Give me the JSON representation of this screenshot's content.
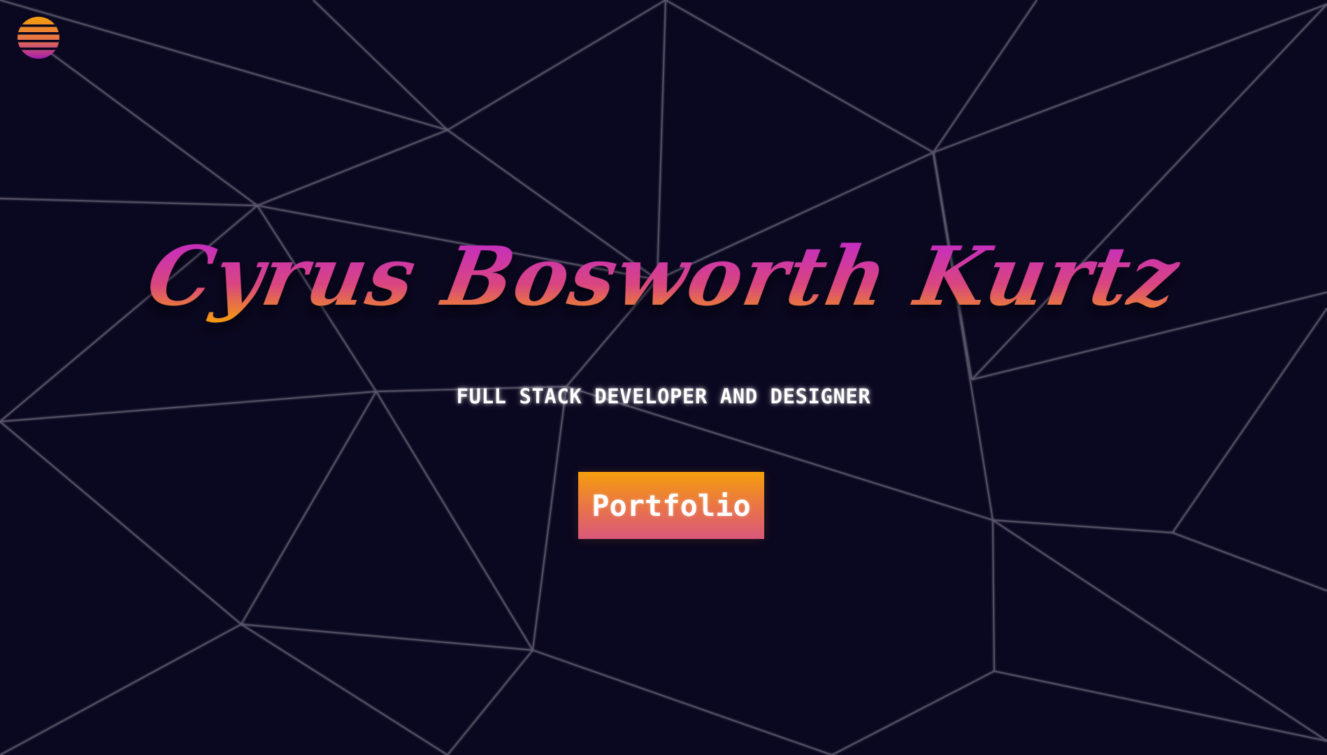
{
  "hero": {
    "name": "Cyrus Bosworth Kurtz",
    "subtitle": "FULL STACK DEVELOPER AND DESIGNER",
    "cta_label": "Portfolio"
  },
  "logo": {
    "icon": "sunset-stripes-logo-icon"
  },
  "colors": {
    "background": "#0a0720",
    "mesh_line": "#5b586b",
    "gradient_top": "#c026d3",
    "gradient_mid": "#d9467f",
    "gradient_bottom": "#f59e0b",
    "button_top": "#f59e0b",
    "button_bottom": "#d9587a",
    "text_white": "#ffffff"
  }
}
